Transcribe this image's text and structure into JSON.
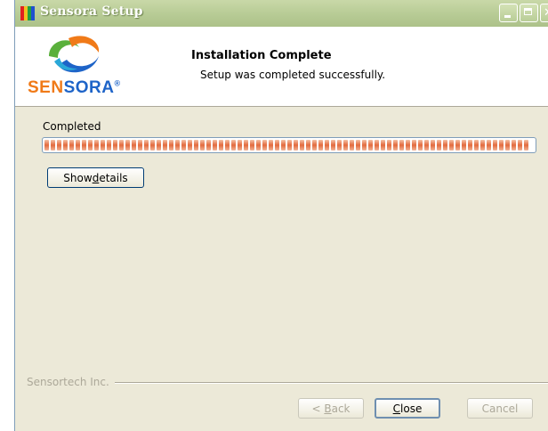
{
  "window": {
    "title": "Sensora Setup",
    "icon": "app-icon-color-bars",
    "icon_colors": [
      "#e02020",
      "#f0c020",
      "#20a040",
      "#2050d0"
    ]
  },
  "header": {
    "logo_text_part1": "SEN",
    "logo_text_part2": "SORA",
    "logo_mark": "®",
    "logo_colors": {
      "orange": "#f07a18",
      "blue": "#1e64c8",
      "green": "#5ab03c",
      "text_orange": "#f07a18",
      "text_blue": "#1e64c8"
    },
    "title": "Installation Complete",
    "subtitle": "Setup was completed successfully."
  },
  "main": {
    "status_label": "Completed",
    "progress": 1.0,
    "progress_color": "#e36a3e",
    "show_details": {
      "label_pre": "Show ",
      "label_ul": "d",
      "label_post": "etails"
    }
  },
  "footer": {
    "brand": "Sensortech Inc.",
    "back": {
      "label_pre": "< ",
      "label_ul": "B",
      "label_post": "ack",
      "enabled": false
    },
    "close": {
      "label_pre": "",
      "label_ul": "C",
      "label_post": "lose",
      "enabled": true
    },
    "cancel": {
      "label": "Cancel",
      "enabled": false
    }
  }
}
